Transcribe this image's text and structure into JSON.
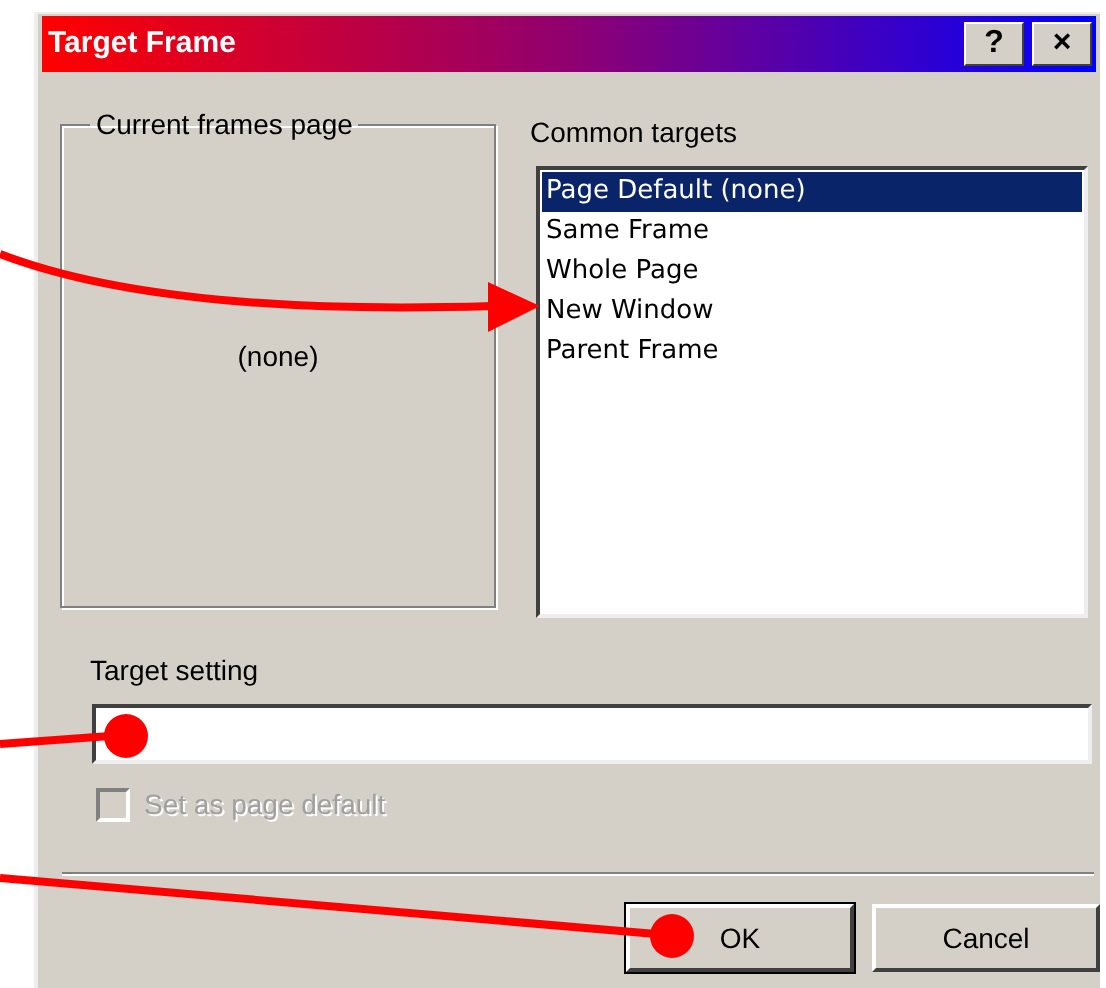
{
  "window": {
    "title": "Target Frame",
    "title_buttons": [
      "?",
      "×"
    ]
  },
  "current_frames_page": {
    "legend": "Current frames page",
    "content": "(none)"
  },
  "common_targets": {
    "label": "Common targets",
    "items": [
      {
        "label": "Page Default (none)",
        "selected": true
      },
      {
        "label": "Same Frame",
        "selected": false
      },
      {
        "label": "Whole Page",
        "selected": false
      },
      {
        "label": "New Window",
        "selected": false
      },
      {
        "label": "Parent Frame",
        "selected": false
      }
    ]
  },
  "target_setting": {
    "label": "Target setting"
  },
  "set_as_page_default": {
    "label": "Set as page default",
    "checked": false,
    "disabled": true
  },
  "buttons": [
    {
      "label": "OK",
      "default": true
    },
    {
      "label": "Cancel",
      "default": false
    }
  ]
}
